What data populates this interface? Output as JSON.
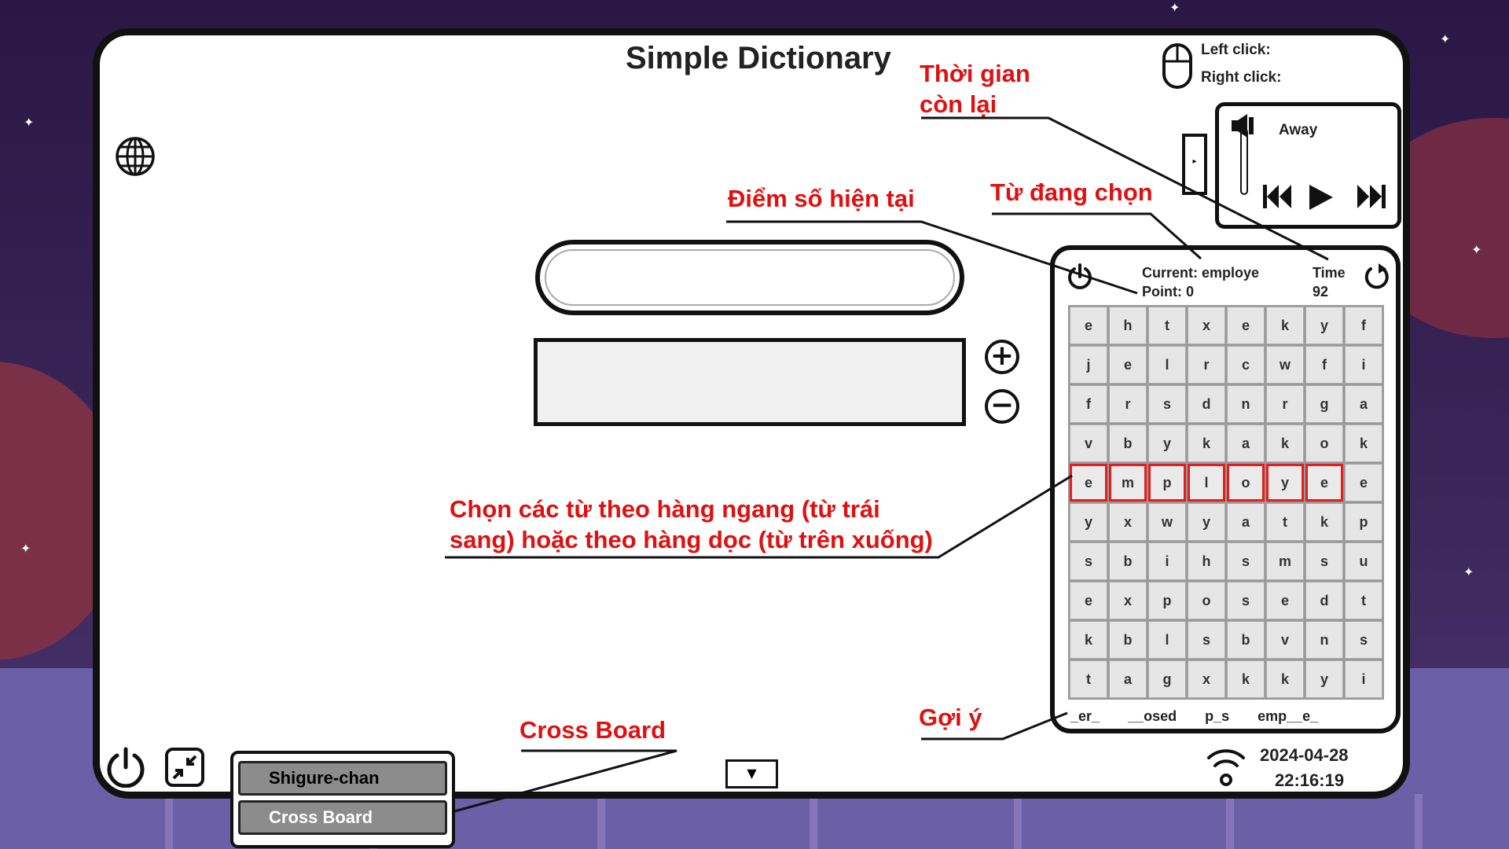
{
  "app": {
    "title": "Simple Dictionary"
  },
  "mouse": {
    "left_label": "Left click:",
    "right_label": "Right click:"
  },
  "player": {
    "track": "Away"
  },
  "game": {
    "current_label": "Current:",
    "current_word": "employe",
    "point_label": "Point:",
    "point_value": "0",
    "time_label": "Time",
    "time_value": "92",
    "grid": [
      [
        "e",
        "h",
        "t",
        "x",
        "e",
        "k",
        "y",
        "f"
      ],
      [
        "j",
        "e",
        "l",
        "r",
        "c",
        "w",
        "f",
        "i"
      ],
      [
        "f",
        "r",
        "s",
        "d",
        "n",
        "r",
        "g",
        "a"
      ],
      [
        "v",
        "b",
        "y",
        "k",
        "a",
        "k",
        "o",
        "k"
      ],
      [
        "e",
        "m",
        "p",
        "l",
        "o",
        "y",
        "e",
        "e"
      ],
      [
        "y",
        "x",
        "w",
        "y",
        "a",
        "t",
        "k",
        "p"
      ],
      [
        "s",
        "b",
        "i",
        "h",
        "s",
        "m",
        "s",
        "u"
      ],
      [
        "e",
        "x",
        "p",
        "o",
        "s",
        "e",
        "d",
        "t"
      ],
      [
        "k",
        "b",
        "l",
        "s",
        "b",
        "v",
        "n",
        "s"
      ],
      [
        "t",
        "a",
        "g",
        "x",
        "k",
        "k",
        "y",
        "i"
      ]
    ],
    "selected_row": 4,
    "selected_cols": [
      0,
      1,
      2,
      3,
      4,
      5,
      6
    ],
    "hints": [
      "_er_",
      "__osed",
      "p_s",
      "emp__e_"
    ]
  },
  "annotations": {
    "time_left": [
      "Thời gian",
      "còn lại"
    ],
    "current_score": "Điểm số hiện tại",
    "selected_word": "Từ đang chọn",
    "instruction": [
      "Chọn các từ theo hàng ngang (từ trái",
      "sang) hoặc theo hàng dọc (từ trên xuống)"
    ],
    "hint": "Gợi ý",
    "cross_board": "Cross Board"
  },
  "taskbar": {
    "menu_items": [
      "Shigure-chan",
      "Cross Board"
    ],
    "dropdown_glyph": "▼"
  },
  "clock": {
    "date": "2024-04-28",
    "time": "22:16:19"
  },
  "colors": {
    "annotation": "#e01010",
    "selection": "#e02020",
    "window_border": "#111111"
  }
}
